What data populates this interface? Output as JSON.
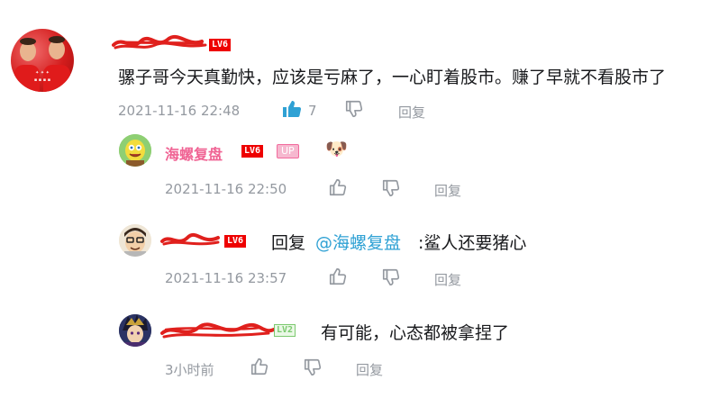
{
  "main_comment": {
    "username": "",
    "level": "LV6",
    "text": "骡子哥今天真勤快，应该是亏麻了，一心盯着股市。赚了早就不看股市了",
    "time": "2021-11-16 22:48",
    "likes": "7",
    "reply_label": "回复"
  },
  "replies": [
    {
      "username": "海螺复盘",
      "level": "LV6",
      "badge": "UP",
      "emoji": "🐶",
      "time": "2021-11-16 22:50",
      "reply_label": "回复"
    },
    {
      "level": "LV6",
      "reply_prefix": "回复",
      "mention": "@海螺复盘",
      "text": ":鲨人还要猪心",
      "time": "2021-11-16 23:57",
      "reply_label": "回复"
    },
    {
      "level": "LV2",
      "text": "有可能，心态都被拿捏了",
      "time": "3小时前",
      "reply_label": "回复"
    }
  ],
  "colors": {
    "accent_blue": "#2fa1d4",
    "up_pink": "#f06494",
    "meta_gray": "#9499a0",
    "level_red": "#e00000"
  }
}
